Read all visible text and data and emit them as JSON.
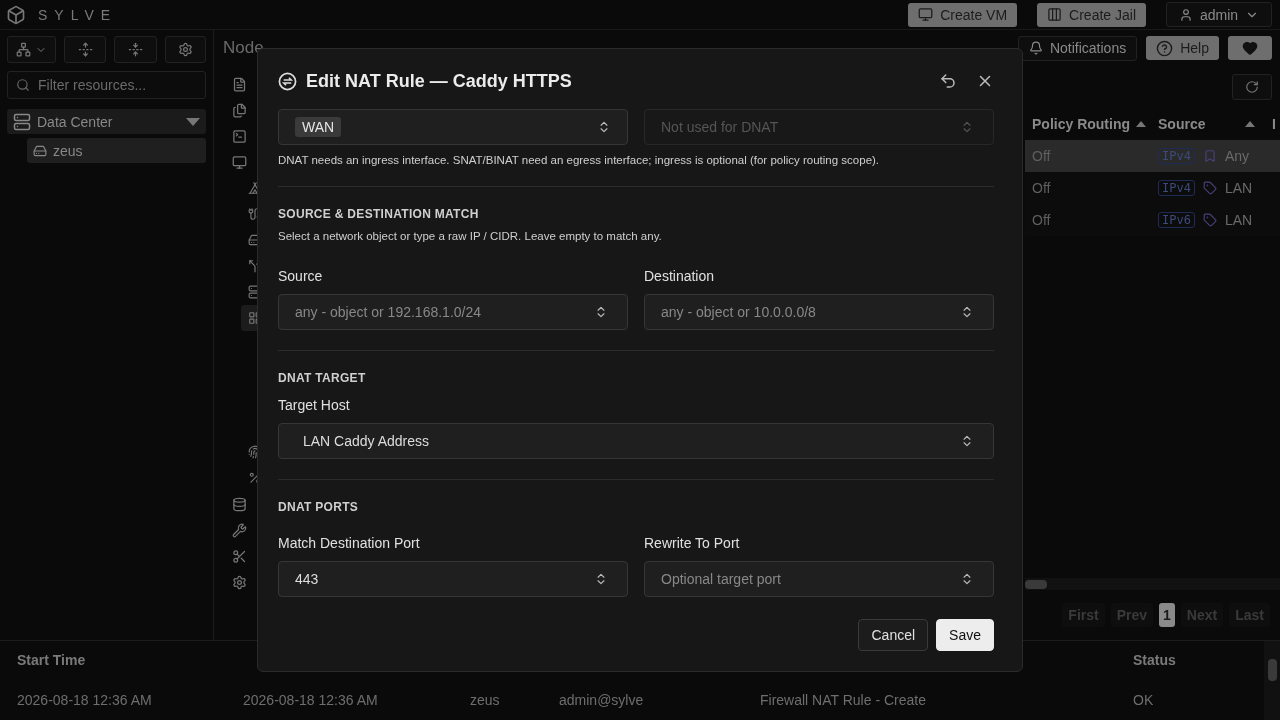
{
  "header": {
    "brand": "SYLVE",
    "actions": [
      {
        "label": "Create VM"
      },
      {
        "label": "Create Jail"
      }
    ],
    "user": "admin"
  },
  "sidebar": {
    "search": {
      "placeholder": "Filter resources..."
    },
    "tree": [
      {
        "label": "Data Center",
        "expanded": true,
        "children": [
          {
            "label": "zeus",
            "selected": true
          }
        ]
      }
    ]
  },
  "main": {
    "breadcrumb": [
      "Node"
    ],
    "toolbar": [
      {
        "label": "Notifications",
        "kind": "outline"
      },
      {
        "label": "Help",
        "kind": "filled"
      }
    ],
    "nav": [
      {
        "selected": false
      },
      {
        "selected": false
      },
      {
        "selected": false
      },
      {
        "selected": false,
        "children": [
          {
            "selected": false
          },
          {
            "selected": false
          },
          {
            "selected": false
          },
          {
            "selected": false
          },
          {
            "selected": false
          },
          {
            "selected": true
          },
          {
            "selected": false
          },
          {
            "selected": false
          }
        ]
      },
      {
        "selected": false
      },
      {
        "selected": false
      },
      {
        "selected": false
      },
      {
        "selected": false
      }
    ],
    "table": {
      "columns": [
        "Policy Routing",
        "Source",
        "I"
      ],
      "rows": [
        {
          "policy_routing": "Off",
          "family": "IPv4",
          "source": "Any",
          "selected": true
        },
        {
          "policy_routing": "Off",
          "family": "IPv4",
          "source": "LAN",
          "selected": false
        },
        {
          "policy_routing": "Off",
          "family": "IPv6",
          "source": "LAN",
          "selected": false
        }
      ]
    },
    "pagination": [
      {
        "label": "First",
        "selected": false,
        "disabled": true
      },
      {
        "label": "Prev",
        "selected": false,
        "disabled": true
      },
      {
        "label": "1",
        "selected": true,
        "disabled": false
      },
      {
        "label": "Next",
        "selected": false,
        "disabled": true
      },
      {
        "label": "Last",
        "selected": false,
        "disabled": true
      }
    ]
  },
  "log": {
    "columns": [
      "Start Time",
      "",
      "",
      "",
      "",
      "Status"
    ],
    "rows": [
      [
        "2026-08-18 12:36 AM",
        "2026-08-18 12:36 AM",
        "zeus",
        "admin@sylve",
        "Firewall NAT Rule - Create",
        "OK"
      ]
    ]
  },
  "dialog": {
    "title": "Edit NAT Rule — Caddy HTTPS",
    "ingress": {
      "value": "WAN",
      "disabled": false
    },
    "egress": {
      "placeholder": "Not used for DNAT",
      "disabled": true
    },
    "interface_hint": "DNAT needs an ingress interface. SNAT/BINAT need an egress interface; ingress is optional (for policy routing scope).",
    "sections": [
      {
        "heading": "SOURCE & DESTINATION MATCH",
        "description": "Select a network object or type a raw IP / CIDR. Leave empty to match any.",
        "fields": [
          {
            "label": "Source",
            "placeholder": "any - object or 192.168.1.0/24"
          },
          {
            "label": "Destination",
            "placeholder": "any - object or 10.0.0.0/8"
          }
        ]
      },
      {
        "heading": "DNAT TARGET",
        "fields": [
          {
            "label": "Target Host",
            "value": "LAN Caddy Address"
          }
        ]
      },
      {
        "heading": "DNAT PORTS",
        "fields": [
          {
            "label": "Match Destination Port",
            "value": "443"
          },
          {
            "label": "Rewrite To Port",
            "placeholder": "Optional target port"
          }
        ]
      }
    ],
    "buttons": [
      {
        "label": "Cancel",
        "kind": "secondary"
      },
      {
        "label": "Save",
        "kind": "primary"
      }
    ]
  }
}
